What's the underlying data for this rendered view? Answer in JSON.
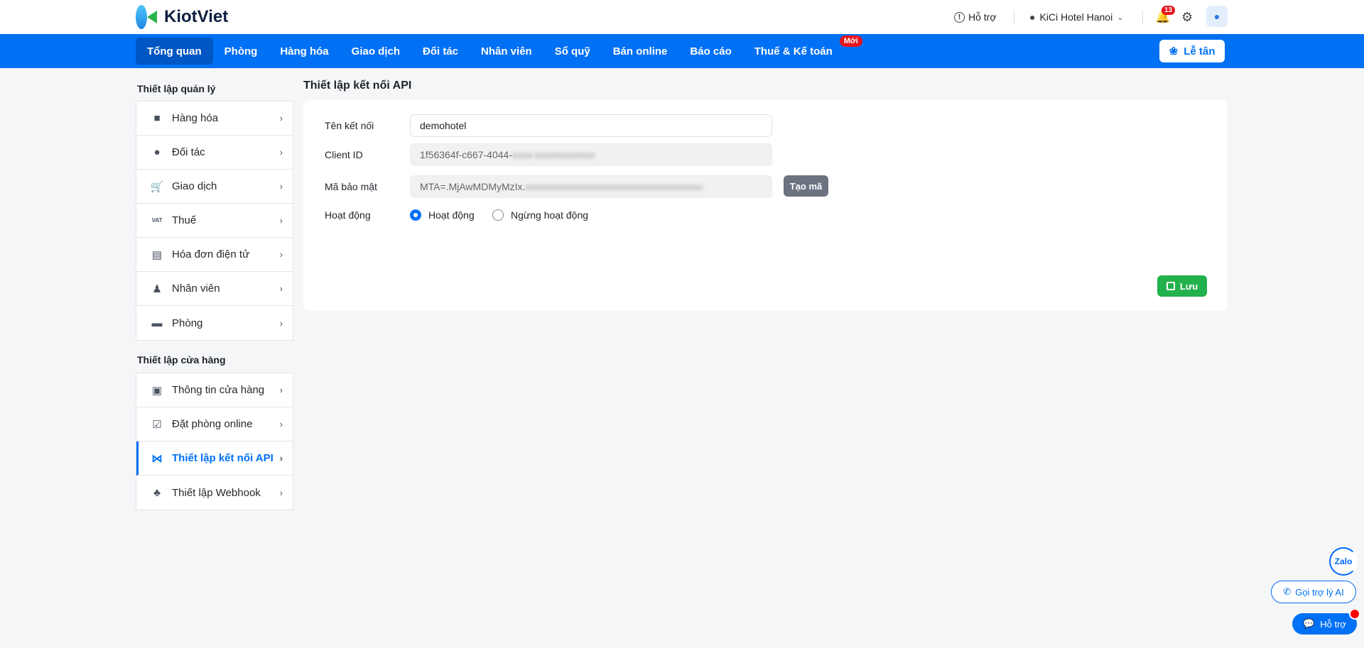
{
  "header": {
    "logo_text": "KiotViet",
    "support_label": "Hỗ trợ",
    "branch": "KiCi Hotel Hanoi",
    "notification_count": "13"
  },
  "nav": {
    "items": [
      {
        "label": "Tổng quan",
        "active": true
      },
      {
        "label": "Phòng"
      },
      {
        "label": "Hàng hóa"
      },
      {
        "label": "Giao dịch"
      },
      {
        "label": "Đối tác"
      },
      {
        "label": "Nhân viên"
      },
      {
        "label": "Sổ quỹ"
      },
      {
        "label": "Bán online"
      },
      {
        "label": "Báo cáo"
      },
      {
        "label": "Thuế & Kế toán",
        "badge": "Mới"
      }
    ],
    "reception_label": "Lễ tân"
  },
  "sidebar": {
    "group1_title": "Thiết lập quản lý",
    "group1": [
      {
        "label": "Hàng hóa",
        "icon": "box-icon"
      },
      {
        "label": "Đối tác",
        "icon": "user-icon"
      },
      {
        "label": "Giao dịch",
        "icon": "cart-icon"
      },
      {
        "label": "Thuế",
        "icon": "vat-icon",
        "icon_text": "VAT"
      },
      {
        "label": "Hóa đơn điện tử",
        "icon": "invoice-icon"
      },
      {
        "label": "Nhân viên",
        "icon": "employee-icon"
      },
      {
        "label": "Phòng",
        "icon": "bed-icon"
      }
    ],
    "group2_title": "Thiết lập cửa hàng",
    "group2": [
      {
        "label": "Thông tin cửa hàng",
        "icon": "store-icon"
      },
      {
        "label": "Đặt phòng online",
        "icon": "calendar-check-icon"
      },
      {
        "label": "Thiết lập kết nối API",
        "icon": "api-network-icon",
        "active": true
      },
      {
        "label": "Thiết lập Webhook",
        "icon": "webhook-icon"
      }
    ]
  },
  "main": {
    "title": "Thiết lập kết nối API",
    "fields": {
      "name_label": "Tên kết nối",
      "name_value": "demohotel",
      "client_id_label": "Client ID",
      "client_id_visible": "1f56364f-c667-4044-",
      "client_id_hidden": "xxxx-xxxxxxxxxxxx",
      "secret_label": "Mã bảo mật",
      "secret_visible": "MTA=.MjAwMDMyMzIx.",
      "secret_hidden": "xxxxxxxxxxxxxxxxxxxxxxxxxxxxxxxxxxxxx",
      "generate_label": "Tạo mã",
      "status_label": "Hoạt động",
      "status_options": [
        "Hoạt động",
        "Ngừng hoạt động"
      ],
      "status_selected": "Hoạt động"
    },
    "save_label": "Lưu"
  },
  "widgets": {
    "zalo": "Zalo",
    "ai_label": "Gọi trợ lý AI",
    "help_label": "Hỗ trợ"
  },
  "colors": {
    "primary": "#0070f4",
    "save": "#22b14c",
    "badge": "#e8141c"
  }
}
